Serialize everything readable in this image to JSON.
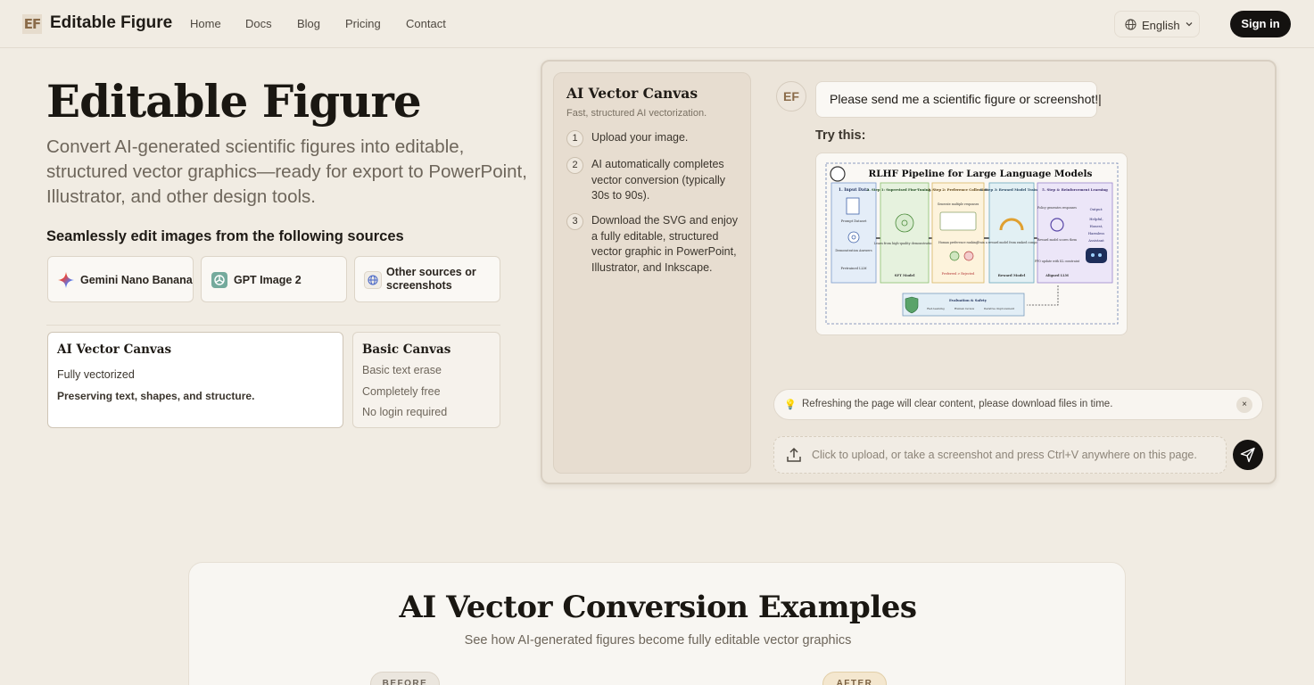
{
  "brand": {
    "mark": "EF",
    "name": "Editable Figure"
  },
  "nav": {
    "links": [
      "Home",
      "Docs",
      "Blog",
      "Pricing",
      "Contact"
    ],
    "language": "English",
    "signin": "Sign in"
  },
  "hero": {
    "title": "Editable Figure",
    "subtitle": "Convert AI-generated scientific figures into editable, structured vector graphics—ready for export to PowerPoint, Illustrator, and other design tools.",
    "sources_heading": "Seamlessly edit images from the following sources",
    "sources": [
      {
        "label": "Gemini Nano Banana",
        "icon": "gemini-sparkle-icon"
      },
      {
        "label": "GPT Image 2",
        "icon": "openai-icon"
      },
      {
        "label": "Other sources or screenshots",
        "icon": "globe-icon"
      }
    ],
    "modes": {
      "ai": {
        "title": "AI Vector Canvas",
        "line1": "Fully vectorized",
        "line2": "Preserving text, shapes, and structure."
      },
      "basic": {
        "title": "Basic Canvas",
        "line1": "Basic text erase",
        "line2": "Completely free",
        "line3": "No login required"
      }
    }
  },
  "panel": {
    "side_title": "AI Vector Canvas",
    "side_subtitle": "Fast, structured AI vectorization.",
    "steps": [
      {
        "num": "1",
        "text": "Upload your image."
      },
      {
        "num": "2",
        "text": "AI automatically completes vector conversion (typically 30s to 90s)."
      },
      {
        "num": "3",
        "text": "Download the SVG and enjoy a fully editable, structured vector graphic in PowerPoint, Illustrator, and Inkscape."
      }
    ],
    "avatar": "EF",
    "message": "Please send me a scientific figure or screenshot!|",
    "try_label": "Try this:",
    "sample": {
      "title": "RLHF Pipeline for Large Language Models",
      "boxes": [
        {
          "title": "1. Input Data",
          "lines": [
            "Prompt Dataset",
            "Demonstration Answers",
            "Pretrained LLM"
          ]
        },
        {
          "title": "2. Step 1: Supervised Fine-Tuning (SFT)",
          "lines": [
            "Learn from high-quality demonstrations",
            "SFT Model"
          ]
        },
        {
          "title": "3. Step 2: Preference Collection",
          "lines": [
            "Generate multiple responses",
            "Human preference ranking",
            "Preferred > Rejected"
          ]
        },
        {
          "title": "4. Step 3: Reward Model Training",
          "lines": [
            "Train a reward model from ranked comparisons",
            "Reward Model"
          ]
        },
        {
          "title": "5. Step 4: Reinforcement Learning",
          "lines": [
            "Policy generates responses",
            "Reward model scores them",
            "PPO update with KL constraint",
            "Aligned LLM"
          ]
        }
      ],
      "output": [
        "Output:",
        "Helpful,",
        "Honest,",
        "Harmless",
        "Assistant"
      ],
      "eval_title": "Evaluation & Safety",
      "eval_items": [
        "Red-teaming",
        "Human review",
        "Iterative improvement"
      ]
    },
    "notice": "Refreshing the page will clear content, please download files in time.",
    "close": "×",
    "upload_placeholder": "Click to upload, or take a screenshot and press Ctrl+V anywhere on this page."
  },
  "examples": {
    "title": "AI Vector Conversion Examples",
    "subtitle": "See how AI-generated figures become fully editable vector graphics",
    "before": "BEFORE",
    "after": "AFTER"
  },
  "colors": {
    "accent": "#141210",
    "background": "#f1ece3",
    "brand": "#8a6b49"
  }
}
